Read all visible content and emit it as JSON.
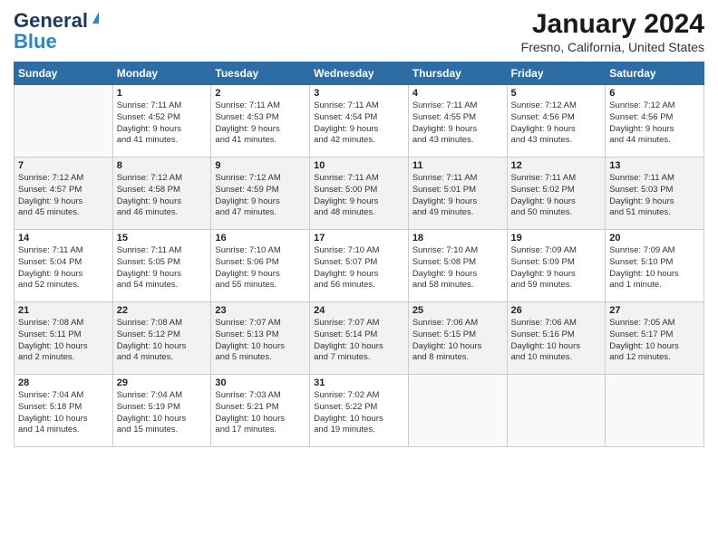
{
  "header": {
    "logo_line1": "General",
    "logo_line2": "Blue",
    "month": "January 2024",
    "location": "Fresno, California, United States"
  },
  "days_of_week": [
    "Sunday",
    "Monday",
    "Tuesday",
    "Wednesday",
    "Thursday",
    "Friday",
    "Saturday"
  ],
  "weeks": [
    [
      {
        "day": "",
        "info": ""
      },
      {
        "day": "1",
        "info": "Sunrise: 7:11 AM\nSunset: 4:52 PM\nDaylight: 9 hours\nand 41 minutes."
      },
      {
        "day": "2",
        "info": "Sunrise: 7:11 AM\nSunset: 4:53 PM\nDaylight: 9 hours\nand 41 minutes."
      },
      {
        "day": "3",
        "info": "Sunrise: 7:11 AM\nSunset: 4:54 PM\nDaylight: 9 hours\nand 42 minutes."
      },
      {
        "day": "4",
        "info": "Sunrise: 7:11 AM\nSunset: 4:55 PM\nDaylight: 9 hours\nand 43 minutes."
      },
      {
        "day": "5",
        "info": "Sunrise: 7:12 AM\nSunset: 4:56 PM\nDaylight: 9 hours\nand 43 minutes."
      },
      {
        "day": "6",
        "info": "Sunrise: 7:12 AM\nSunset: 4:56 PM\nDaylight: 9 hours\nand 44 minutes."
      }
    ],
    [
      {
        "day": "7",
        "info": "Sunrise: 7:12 AM\nSunset: 4:57 PM\nDaylight: 9 hours\nand 45 minutes."
      },
      {
        "day": "8",
        "info": "Sunrise: 7:12 AM\nSunset: 4:58 PM\nDaylight: 9 hours\nand 46 minutes."
      },
      {
        "day": "9",
        "info": "Sunrise: 7:12 AM\nSunset: 4:59 PM\nDaylight: 9 hours\nand 47 minutes."
      },
      {
        "day": "10",
        "info": "Sunrise: 7:11 AM\nSunset: 5:00 PM\nDaylight: 9 hours\nand 48 minutes."
      },
      {
        "day": "11",
        "info": "Sunrise: 7:11 AM\nSunset: 5:01 PM\nDaylight: 9 hours\nand 49 minutes."
      },
      {
        "day": "12",
        "info": "Sunrise: 7:11 AM\nSunset: 5:02 PM\nDaylight: 9 hours\nand 50 minutes."
      },
      {
        "day": "13",
        "info": "Sunrise: 7:11 AM\nSunset: 5:03 PM\nDaylight: 9 hours\nand 51 minutes."
      }
    ],
    [
      {
        "day": "14",
        "info": "Sunrise: 7:11 AM\nSunset: 5:04 PM\nDaylight: 9 hours\nand 52 minutes."
      },
      {
        "day": "15",
        "info": "Sunrise: 7:11 AM\nSunset: 5:05 PM\nDaylight: 9 hours\nand 54 minutes."
      },
      {
        "day": "16",
        "info": "Sunrise: 7:10 AM\nSunset: 5:06 PM\nDaylight: 9 hours\nand 55 minutes."
      },
      {
        "day": "17",
        "info": "Sunrise: 7:10 AM\nSunset: 5:07 PM\nDaylight: 9 hours\nand 56 minutes."
      },
      {
        "day": "18",
        "info": "Sunrise: 7:10 AM\nSunset: 5:08 PM\nDaylight: 9 hours\nand 58 minutes."
      },
      {
        "day": "19",
        "info": "Sunrise: 7:09 AM\nSunset: 5:09 PM\nDaylight: 9 hours\nand 59 minutes."
      },
      {
        "day": "20",
        "info": "Sunrise: 7:09 AM\nSunset: 5:10 PM\nDaylight: 10 hours\nand 1 minute."
      }
    ],
    [
      {
        "day": "21",
        "info": "Sunrise: 7:08 AM\nSunset: 5:11 PM\nDaylight: 10 hours\nand 2 minutes."
      },
      {
        "day": "22",
        "info": "Sunrise: 7:08 AM\nSunset: 5:12 PM\nDaylight: 10 hours\nand 4 minutes."
      },
      {
        "day": "23",
        "info": "Sunrise: 7:07 AM\nSunset: 5:13 PM\nDaylight: 10 hours\nand 5 minutes."
      },
      {
        "day": "24",
        "info": "Sunrise: 7:07 AM\nSunset: 5:14 PM\nDaylight: 10 hours\nand 7 minutes."
      },
      {
        "day": "25",
        "info": "Sunrise: 7:06 AM\nSunset: 5:15 PM\nDaylight: 10 hours\nand 8 minutes."
      },
      {
        "day": "26",
        "info": "Sunrise: 7:06 AM\nSunset: 5:16 PM\nDaylight: 10 hours\nand 10 minutes."
      },
      {
        "day": "27",
        "info": "Sunrise: 7:05 AM\nSunset: 5:17 PM\nDaylight: 10 hours\nand 12 minutes."
      }
    ],
    [
      {
        "day": "28",
        "info": "Sunrise: 7:04 AM\nSunset: 5:18 PM\nDaylight: 10 hours\nand 14 minutes."
      },
      {
        "day": "29",
        "info": "Sunrise: 7:04 AM\nSunset: 5:19 PM\nDaylight: 10 hours\nand 15 minutes."
      },
      {
        "day": "30",
        "info": "Sunrise: 7:03 AM\nSunset: 5:21 PM\nDaylight: 10 hours\nand 17 minutes."
      },
      {
        "day": "31",
        "info": "Sunrise: 7:02 AM\nSunset: 5:22 PM\nDaylight: 10 hours\nand 19 minutes."
      },
      {
        "day": "",
        "info": ""
      },
      {
        "day": "",
        "info": ""
      },
      {
        "day": "",
        "info": ""
      }
    ]
  ]
}
